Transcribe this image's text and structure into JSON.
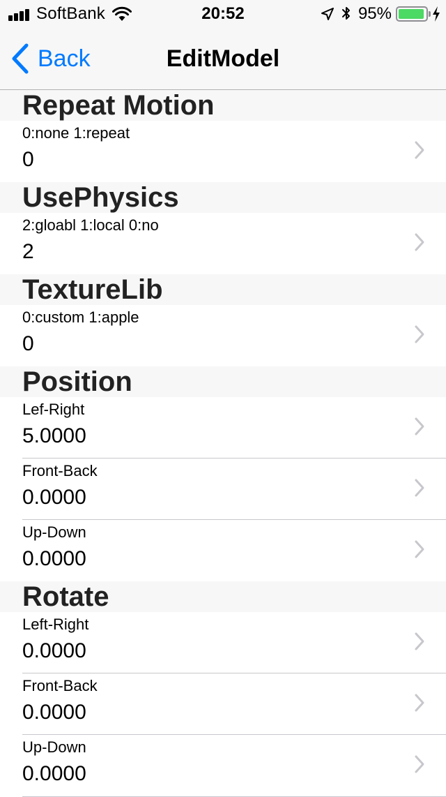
{
  "status_bar": {
    "carrier": "SoftBank",
    "time": "20:52",
    "battery_percent": "95%",
    "battery_level": 0.95,
    "battery_color": "#4cd964"
  },
  "nav": {
    "back_label": "Back",
    "title": "EditModel",
    "accent_color": "#007aff"
  },
  "sections": [
    {
      "header": "Repeat Motion",
      "rows": [
        {
          "label": "0:none 1:repeat",
          "value": "0"
        }
      ]
    },
    {
      "header": "UsePhysics",
      "rows": [
        {
          "label": "2:gloabl 1:local 0:no",
          "value": "2"
        }
      ]
    },
    {
      "header": "TextureLib",
      "rows": [
        {
          "label": "0:custom 1:apple",
          "value": "0"
        }
      ]
    },
    {
      "header": "Position",
      "rows": [
        {
          "label": "Lef-Right",
          "value": "5.0000"
        },
        {
          "label": "Front-Back",
          "value": "0.0000"
        },
        {
          "label": "Up-Down",
          "value": "0.0000"
        }
      ]
    },
    {
      "header": "Rotate",
      "rows": [
        {
          "label": "Left-Right",
          "value": "0.0000"
        },
        {
          "label": "Front-Back",
          "value": "0.0000"
        },
        {
          "label": "Up-Down",
          "value": "0.0000"
        }
      ]
    }
  ]
}
